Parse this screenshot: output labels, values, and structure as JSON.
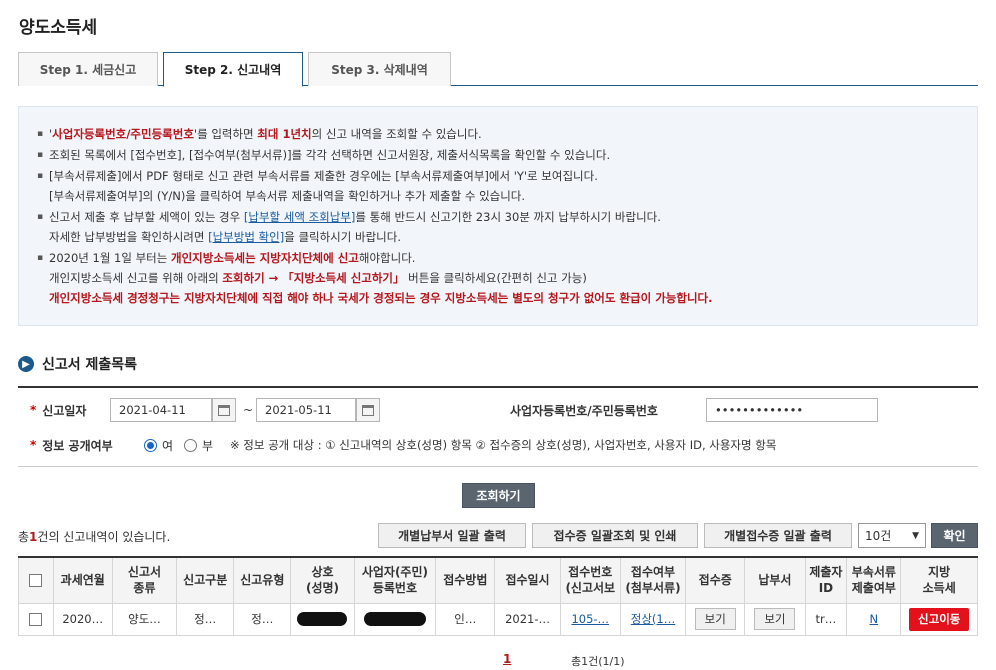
{
  "page": {
    "title": "양도소득세"
  },
  "tabs": [
    {
      "label": "Step 1. 세금신고",
      "active": false
    },
    {
      "label": "Step 2. 신고내역",
      "active": true
    },
    {
      "label": "Step 3. 삭제내역",
      "active": false
    }
  ],
  "notice": {
    "i1_a": "'",
    "i1_b": "사업자등록번호/주민등록번호",
    "i1_c": "'를 입력하면 ",
    "i1_d": "최대 1년치",
    "i1_e": "의 신고 내역을 조회할 수 있습니다.",
    "i2": "조회된 목록에서 [접수번호], [접수여부(첨부서류)]를 각각 선택하면 신고서원장, 제출서식목록을 확인할 수 있습니다.",
    "i3_l1": "[부속서류제출]에서 PDF 형태로 신고 관련 부속서류를 제출한 경우에는 [부속서류제출여부]에서 'Y'로 보여집니다.",
    "i3_l2": "[부속서류제출여부]의 (Y/N)을 클릭하여 부속서류 제출내역을 확인하거나 추가 제출할 수 있습니다.",
    "i4_a": "신고서 제출 후 납부할 세액이 있는 경우 ",
    "i4_link": "[납부할 세액 조회납부]",
    "i4_b": "를 통해 반드시 신고기한 23시 30분 까지 납부하시기 바랍니다.",
    "i4_c": "자세한 납부방법을 확인하시려면 ",
    "i4_link2": "[납부방법 확인]",
    "i4_d": "을 클릭하시기 바랍니다.",
    "i5_a": "2020년 1월 1일 부터는 ",
    "i5_b": "개인지방소득세는 지방자치단체에 신고",
    "i5_c": "해야합니다.",
    "i5_d": "개인지방소득세 신고를 위해 아래의 ",
    "i5_e": "조회하기 → 「지방소득세 신고하기」",
    "i5_f": " 버튼을 클릭하세요(간편히 신고 가능)",
    "i5_warn": "개인지방소득세 경정청구는 지방자치단체에 직접 해야 하나 국세가 경정되는 경우 지방소득세는 별도의 청구가 없어도 환급이 가능합니다."
  },
  "section": {
    "title": "신고서 제출목록",
    "icon": "arrow-circle-icon"
  },
  "form": {
    "date_label": "신고일자",
    "date_from": "2021-04-11",
    "date_sep": "~",
    "date_to": "2021-05-11",
    "id_label": "사업자등록번호/주민등록번호",
    "id_value": "•••••••••••••",
    "open_label": "정보 공개여부",
    "open_yes": "여",
    "open_no": "부",
    "open_note": "※ 정보 공개 대상 : ① 신고내역의 상호(성명) 항목 ② 접수증의 상호(성명), 사업자번호, 사용자 ID, 사용자명 항목",
    "search_button": "조회하기"
  },
  "list": {
    "count_prefix": "총",
    "count": "1",
    "count_suffix": "건의 신고내역이 있습니다.",
    "btn_bulk_print": "개별납부서 일괄 출력",
    "btn_receipt_print": "접수증 일괄조회 및 인쇄",
    "btn_receipt_bulk": "개별접수증 일괄 출력",
    "page_size": "10건",
    "confirm": "확인"
  },
  "table": {
    "headers": [
      "",
      "과세연월",
      "신고서\n종류",
      "신고구분",
      "신고유형",
      "상호\n(성명)",
      "사업자(주민)\n등록번호",
      "접수방법",
      "접수일시",
      "접수번호\n(신고서보기)",
      "접수여부\n(첨부서류)",
      "접수증",
      "납부서",
      "제출자\nID",
      "부속서류\n제출여부",
      "지방\n소득세"
    ],
    "row": {
      "period": "2020…",
      "type": "양도…",
      "category": "정…",
      "kind": "정…",
      "method": "인…",
      "date": "2021-…",
      "receipt_no": "105-…",
      "status": "정상(1…",
      "receipt_btn": "보기",
      "payment_btn": "보기",
      "submitter": "tr…",
      "attach": "N",
      "local_btn": "신고이동"
    }
  },
  "pager": {
    "current": "1",
    "total": "총1건(1/1)"
  }
}
